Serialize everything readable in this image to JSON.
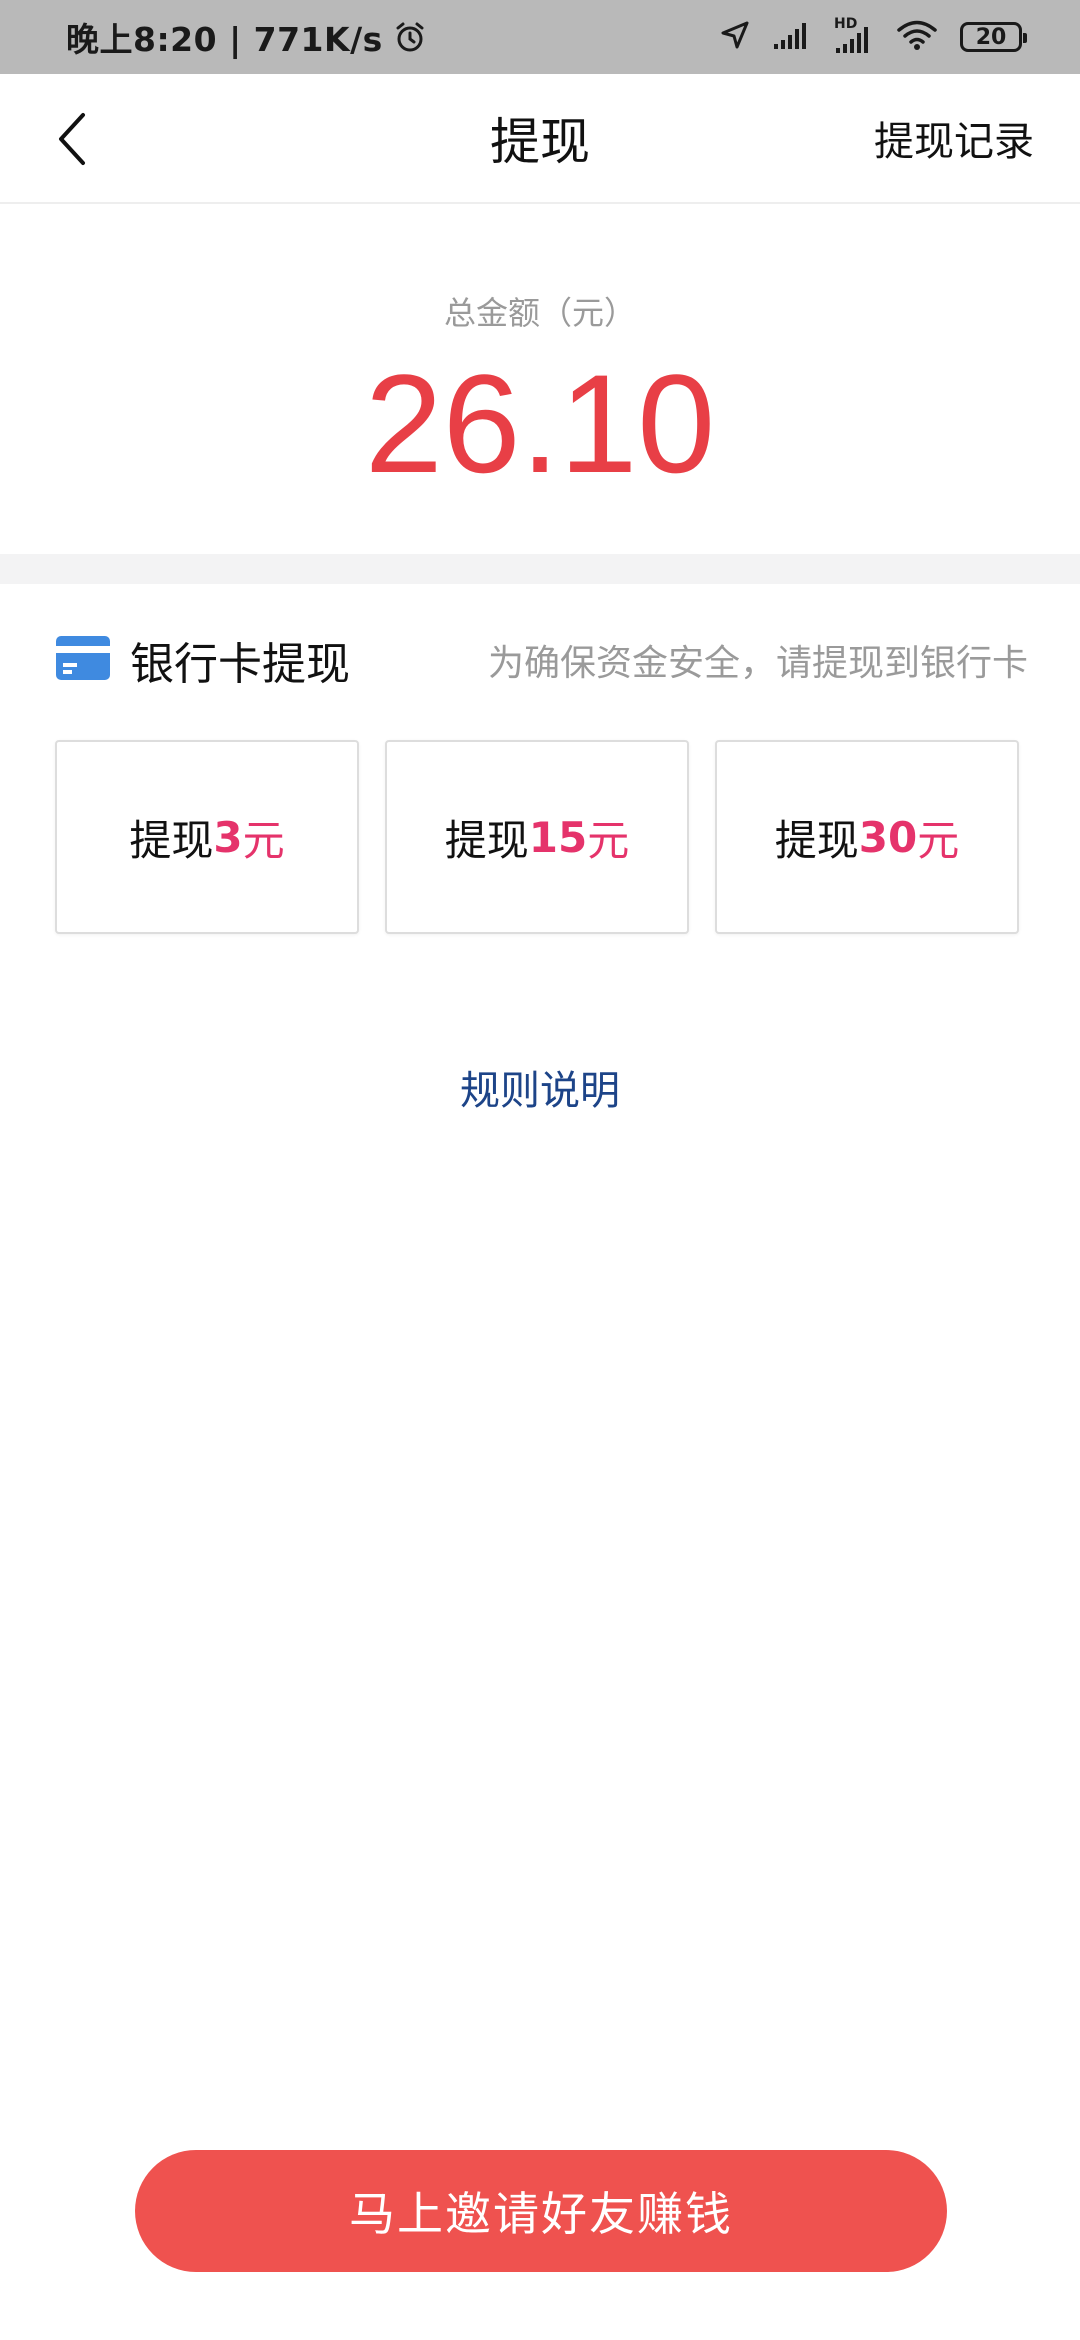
{
  "status_bar": {
    "time_speed": "晚上8:20 | 771K/s",
    "network_label": "HD",
    "battery": "20"
  },
  "header": {
    "title": "提现",
    "record_label": "提现记录"
  },
  "summary": {
    "label": "总金额（元）",
    "amount": "26.10"
  },
  "bank": {
    "title": "银行卡提现",
    "hint": "为确保资金安全，请提现到银行卡"
  },
  "options": [
    {
      "prefix": "提现",
      "amount": "3",
      "unit": "元"
    },
    {
      "prefix": "提现",
      "amount": "15",
      "unit": "元"
    },
    {
      "prefix": "提现",
      "amount": "30",
      "unit": "元"
    }
  ],
  "rules_label": "规则说明",
  "cta_label": "马上邀请好友赚钱",
  "colors": {
    "amount": "#e83f46",
    "option_amount": "#e5336b",
    "link": "#1d4488",
    "cta": "#ef524f",
    "bank_icon": "#3f8ae0"
  },
  "icons": {
    "back": "chevron-left-icon",
    "alarm": "alarm-icon",
    "location": "location-arrow-icon",
    "signal": "signal-icon",
    "wifi": "wifi-icon",
    "battery": "battery-icon",
    "bank_card": "bank-card-icon"
  }
}
